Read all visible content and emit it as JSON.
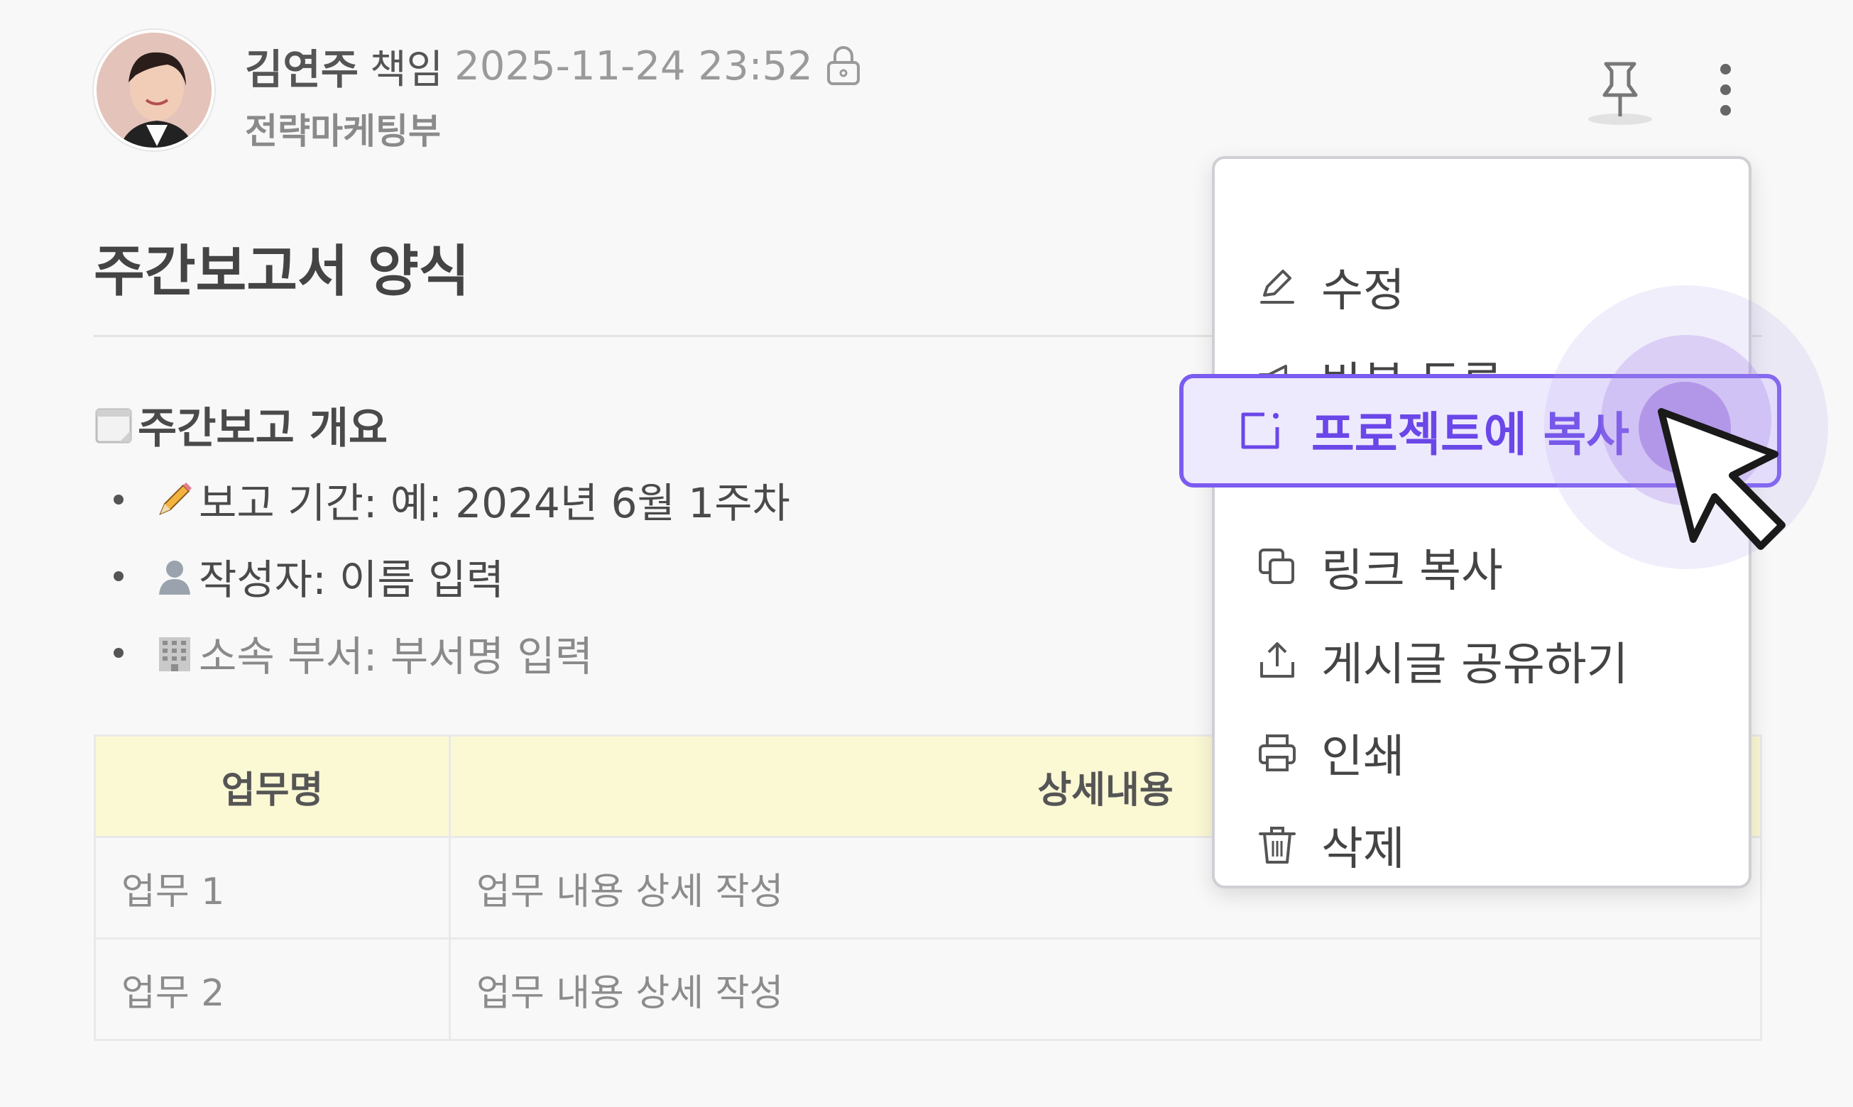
{
  "author": {
    "name": "김연주",
    "role": "책임",
    "timestamp": "2025-11-24 23:52",
    "department": "전략마케팅부"
  },
  "document": {
    "title": "주간보고서 양식",
    "overview_heading": "주간보고 개요",
    "bullets": [
      "보고 기간: 예: 2024년 6월 1주차",
      "작성자: 이름 입력",
      "소속 부서: 부서명 입력"
    ]
  },
  "table": {
    "headers": [
      "업무명",
      "상세내용"
    ],
    "rows": [
      [
        "업무 1",
        "업무 내용 상세 작성"
      ],
      [
        "업무 2",
        "업무 내용 상세 작성"
      ]
    ]
  },
  "menu": {
    "items": [
      {
        "label": "수정",
        "icon": "pencil-icon"
      },
      {
        "label": "반복 등록",
        "icon": "megaphone-icon"
      },
      {
        "label": "프로젝트에 복사",
        "icon": "copy-to-project-icon",
        "highlighted": true
      },
      {
        "label": "링크 복사",
        "icon": "copy-icon"
      },
      {
        "label": "게시글 공유하기",
        "icon": "share-icon"
      },
      {
        "label": "인쇄",
        "icon": "printer-icon"
      },
      {
        "label": "삭제",
        "icon": "trash-icon"
      }
    ]
  },
  "colors": {
    "accent": "#7b5cf0",
    "highlight_bg": "#eeeafe",
    "table_header_bg": "#fbf8d4"
  }
}
